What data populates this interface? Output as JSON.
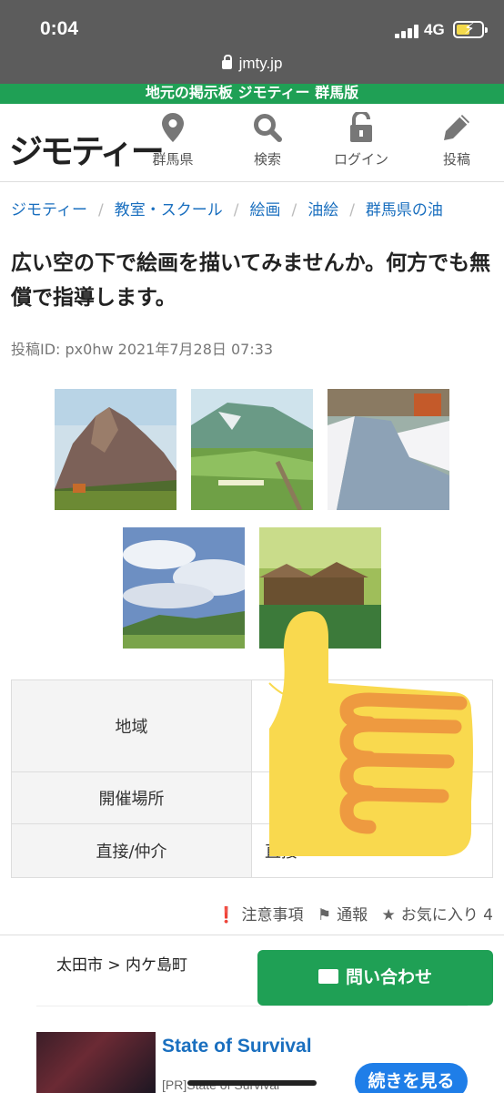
{
  "status": {
    "time": "0:04",
    "network": "4G",
    "url": "jmty.jp"
  },
  "banner": "地元の掲示板 ジモティー 群馬版",
  "header": {
    "logo": "ジモティー",
    "nav": [
      {
        "label": "群馬県",
        "icon": "map-pin-icon"
      },
      {
        "label": "検索",
        "icon": "search-icon"
      },
      {
        "label": "ログイン",
        "icon": "unlock-icon"
      },
      {
        "label": "投稿",
        "icon": "pencil-icon"
      }
    ]
  },
  "breadcrumb": [
    "ジモティー",
    "教室・スクール",
    "絵画",
    "油絵",
    "群馬県の油"
  ],
  "post": {
    "title": "広い空の下で絵画を描いてみませんか。何方でも無償で指導します。",
    "id_line": "投稿ID: px0hw 2021年7月28日 07:33"
  },
  "thumbnails": [
    "mountain-painting",
    "valley-painting",
    "snow-river-painting",
    "sky-painting",
    "watermill-painting"
  ],
  "info": [
    {
      "key": "地域",
      "value": ""
    },
    {
      "key": "開催場所",
      "value": ""
    },
    {
      "key": "直接/仲介",
      "value": "直接"
    }
  ],
  "actions": {
    "notice": "注意事項",
    "report": "通報",
    "favorite": "お気に入り",
    "favorite_count": "4"
  },
  "location": "太田市 > 内ケ島町",
  "contact_button": "問い合わせ",
  "ad": {
    "title": "State of Survival",
    "sub": "[PR]State of Survival",
    "more": "続きを見る"
  },
  "colors": {
    "brand_green": "#1fa055",
    "link_blue": "#1a6fbf",
    "ad_button": "#1f7ee8",
    "emoji_yellow": "#f9d94e",
    "emoji_orange": "#ee9a40"
  }
}
